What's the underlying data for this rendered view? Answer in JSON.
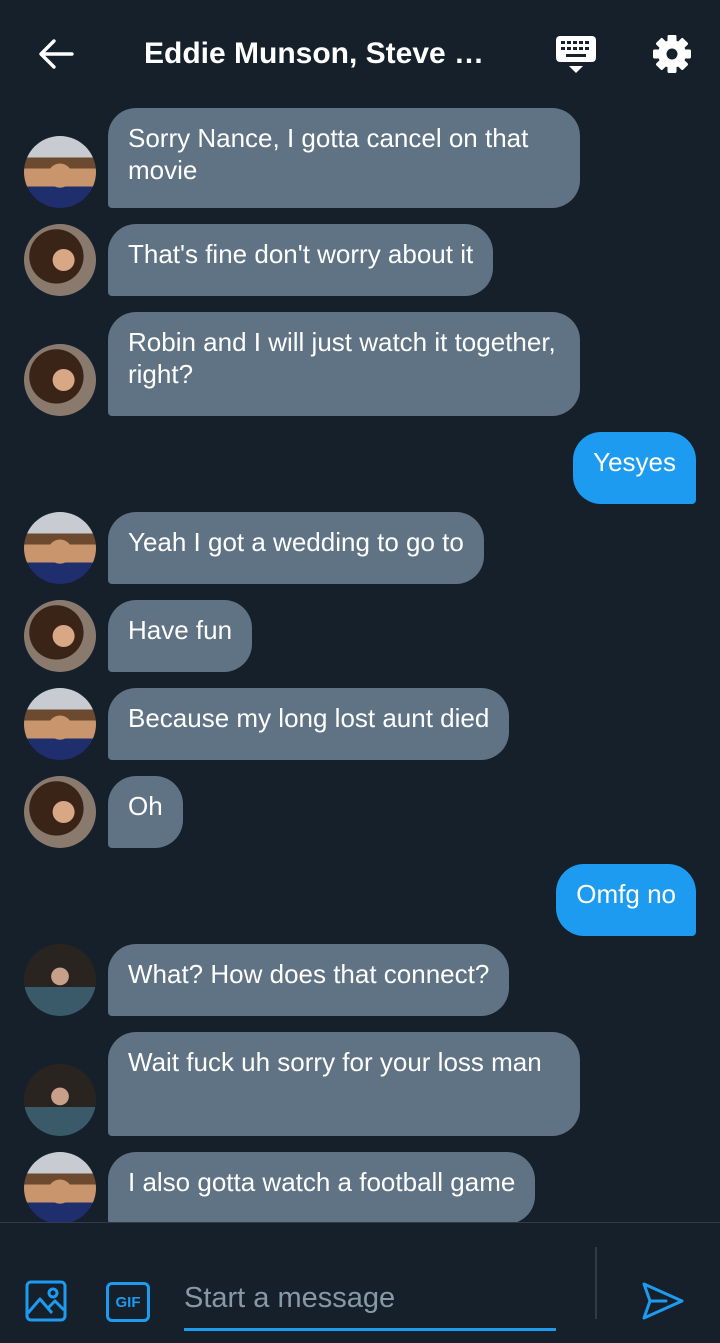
{
  "header": {
    "title": "Eddie Munson, Steve …",
    "icons": [
      "back-arrow-icon",
      "keyboard-icon",
      "gear-icon"
    ]
  },
  "messages": [
    {
      "from": "steve",
      "side": "in",
      "text": "Sorry Nance, I gotta cancel on that movie"
    },
    {
      "from": "robin",
      "side": "in",
      "text": "That's fine don't worry about it"
    },
    {
      "from": "robin",
      "side": "in",
      "text": "Robin and I will just watch it together, right?"
    },
    {
      "from": "me",
      "side": "out",
      "text": "Yesyes"
    },
    {
      "from": "steve",
      "side": "in",
      "text": "Yeah I got a wedding to go to"
    },
    {
      "from": "robin",
      "side": "in",
      "text": "Have fun"
    },
    {
      "from": "steve",
      "side": "in",
      "text": "Because my long lost aunt died"
    },
    {
      "from": "robin",
      "side": "in",
      "text": "Oh"
    },
    {
      "from": "me",
      "side": "out",
      "text": "Omfg no"
    },
    {
      "from": "eddie",
      "side": "in",
      "text": "What? How does that connect?"
    },
    {
      "from": "eddie",
      "side": "in",
      "text": "Wait fuck uh sorry for your loss man"
    },
    {
      "from": "steve",
      "side": "in",
      "text": "I also gotta watch a football game"
    }
  ],
  "composer": {
    "gif_label": "GIF",
    "placeholder": "Start a message",
    "value": ""
  },
  "colors": {
    "background": "#15202b",
    "incoming_bubble": "#5f7384",
    "outgoing_bubble": "#1d9bf0",
    "accent": "#1d9bf0"
  }
}
